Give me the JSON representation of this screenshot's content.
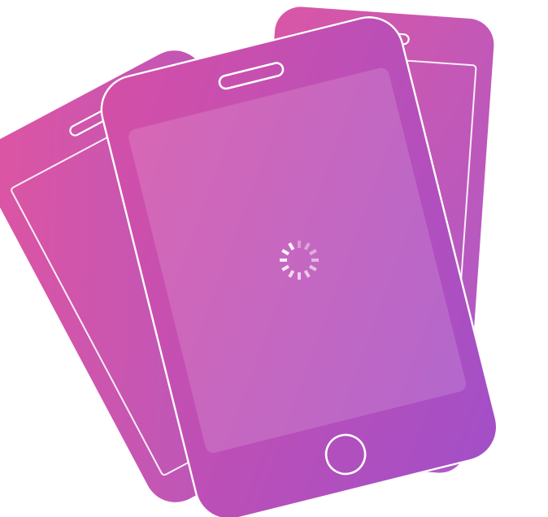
{
  "colors": {
    "gradient_start": "#d9509f",
    "gradient_end": "#a24fc6",
    "outline": "#ffffff",
    "screen_overlay": "#ffffff",
    "spinner": "#ffffff"
  },
  "phones": [
    {
      "name": "phone-left-back"
    },
    {
      "name": "phone-right-back"
    },
    {
      "name": "phone-front"
    }
  ],
  "spinner": {
    "icon": "loading-spinner-icon",
    "segments": 12
  }
}
